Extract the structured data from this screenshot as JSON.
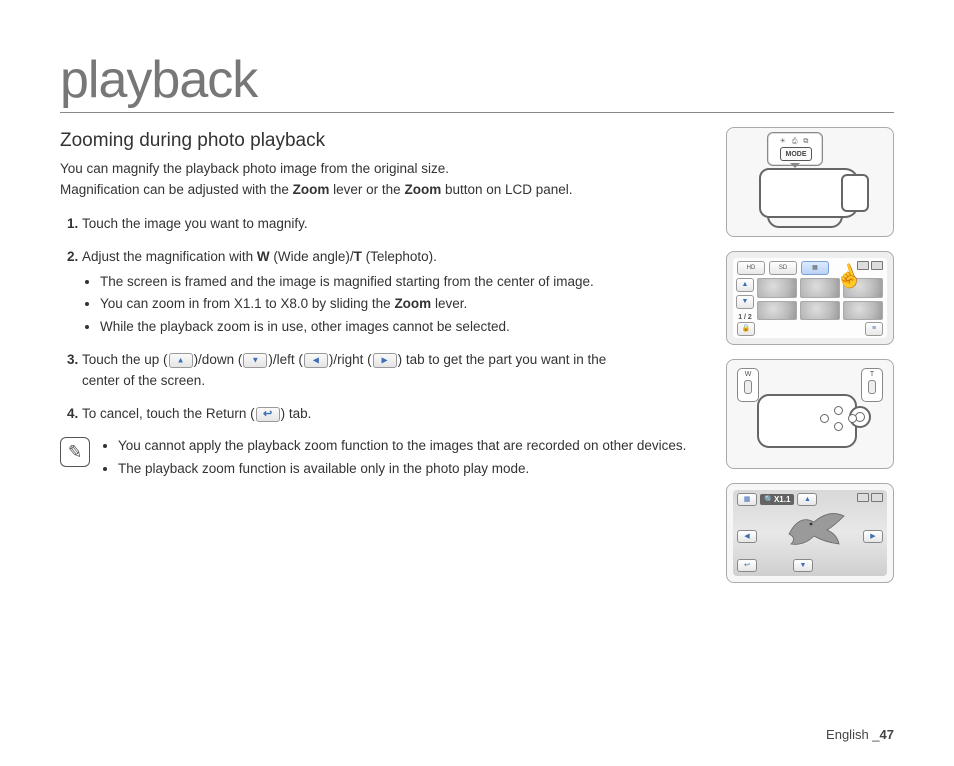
{
  "page_title": "playback",
  "section_heading": "Zooming during photo playback",
  "intro": {
    "line1": "You can magnify the playback photo image from the original size.",
    "line2_pre": "Magnification can be adjusted with the ",
    "line2_b1": "Zoom",
    "line2_mid": " lever or the ",
    "line2_b2": "Zoom",
    "line2_post": " button on LCD panel."
  },
  "steps": {
    "s1": "Touch the image you want to magnify.",
    "s2_pre": "Adjust the magnification with ",
    "s2_w": "W",
    "s2_mid1": " (Wide angle)/",
    "s2_t": "T",
    "s2_mid2": " (Telephoto).",
    "s2_b1": "The screen is framed and the image is magnified starting from the center of image.",
    "s2_b2_pre": "You can zoom in from X1.1 to X8.0 by sliding the ",
    "s2_b2_b": "Zoom",
    "s2_b2_post": " lever.",
    "s2_b3": "While the playback zoom is in use, other images cannot be selected.",
    "s3_pre": "Touch the up (",
    "s3_mid1": ")/down (",
    "s3_mid2": ")/left (",
    "s3_mid3": ")/right (",
    "s3_mid4": ") tab to get the part you want in the",
    "s3_line2": "center of the screen.",
    "s4_pre": "To cancel, touch the Return (",
    "s4_post": ") tab."
  },
  "notes": {
    "n1": "You cannot apply the playback zoom function to the images that are recorded on other devices.",
    "n2": "The playback zoom function is available only in the photo play mode."
  },
  "fig1": {
    "mode_label": "MODE",
    "top_icons": "☀ ⎙ ⧉"
  },
  "fig2": {
    "tab_hd": "HD",
    "tab_sd": "SD",
    "pager": "1 / 2"
  },
  "fig3": {
    "w": "W",
    "t": "T"
  },
  "fig4": {
    "zoom": "X1.1"
  },
  "footer": {
    "lang": "English",
    "sep": " _",
    "page": "47"
  }
}
